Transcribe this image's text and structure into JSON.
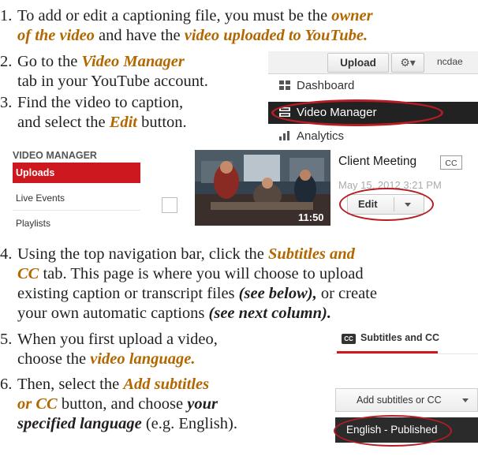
{
  "steps": [
    {
      "num": "1.",
      "p1": "To add or edit a captioning file, you must be the ",
      "em1": "owner",
      "em2": "of the video",
      "p2": " and have the ",
      "em3": "video uploaded to YouTube."
    },
    {
      "num": "2.",
      "p1": "Go to the ",
      "em1": "Video Manager",
      "p2": "tab in your YouTube account."
    },
    {
      "num": "3.",
      "p1": "Find the video to caption,",
      "p2": "and select the ",
      "em1": "Edit",
      "p3": " button."
    },
    {
      "num": "4.",
      "p1": "Using the top navigation bar, click the ",
      "em1": "Subtitles and",
      "em2": "CC",
      "p2": " tab. This page is where you will choose to upload",
      "p3": "existing caption or transcript files ",
      "em3": "(see below),",
      "p4": " or create",
      "p5": "your own automatic captions ",
      "em4": "(see next column)."
    },
    {
      "num": "5.",
      "p1": "When you first upload a video,",
      "p2": "choose the ",
      "em1": "video language."
    },
    {
      "num": "6.",
      "p1": "Then, select the ",
      "em1": "Add subtitles",
      "em2": "or CC",
      "p2": " button, and choose ",
      "em3": "your",
      "em4": "specified language",
      "p3": " (e.g. English)."
    }
  ],
  "yt_menu": {
    "upload_label": "Upload",
    "gear_symbol": "⚙▾",
    "username": "ncdae",
    "items": [
      "Dashboard",
      "Video Manager",
      "Analytics"
    ],
    "selected_index": 1
  },
  "video_manager": {
    "sidebar_title": "VIDEO MANAGER",
    "sidebar_items": [
      "Uploads",
      "Live Events",
      "Playlists"
    ],
    "video": {
      "title": "Client Meeting",
      "cc_badge": "CC",
      "date": "May 15, 2012 3:21 PM",
      "duration": "11:50",
      "edit_label": "Edit"
    }
  },
  "subtitles_panel": {
    "cc_icon": "CC",
    "tab_label": "Subtitles and CC",
    "add_button": "Add subtitles or CC",
    "language_item": "English - Published"
  },
  "colors": {
    "emphasis": "#b26700",
    "highlight_oval": "#b51d23",
    "youtube_red": "#cc181e"
  }
}
